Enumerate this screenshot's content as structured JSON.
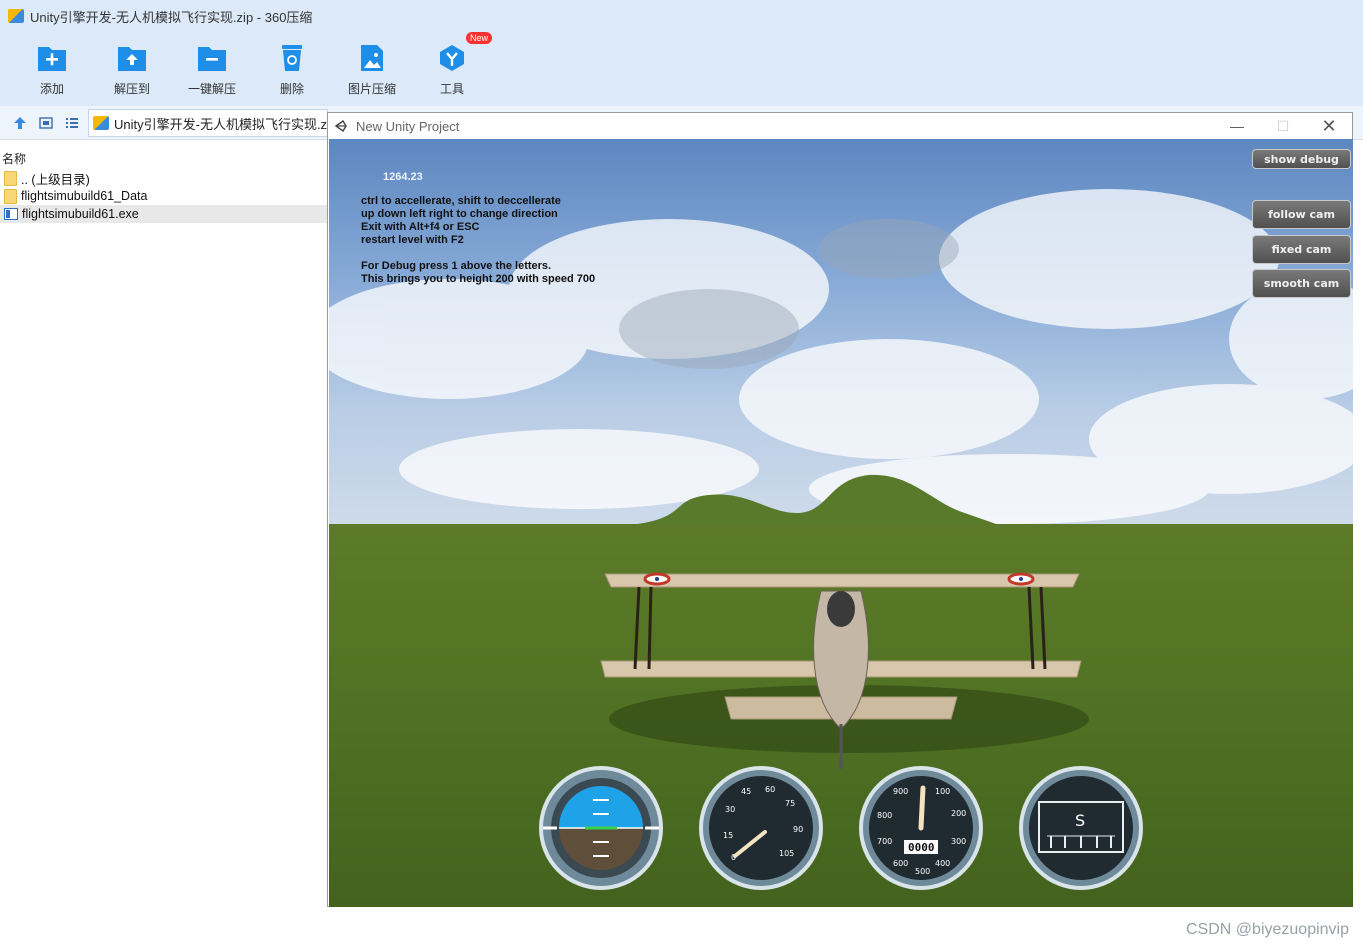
{
  "zip": {
    "title": "Unity引擎开发-无人机模拟飞行实现.zip - 360压缩",
    "toolbar": [
      {
        "label": "添加",
        "icon": "add-icon"
      },
      {
        "label": "解压到",
        "icon": "extract-to-icon"
      },
      {
        "label": "一键解压",
        "icon": "one-click-extract-icon"
      },
      {
        "label": "删除",
        "icon": "delete-icon"
      },
      {
        "label": "图片压缩",
        "icon": "image-compress-icon"
      },
      {
        "label": "工具",
        "icon": "tools-icon",
        "badge": "New"
      }
    ],
    "path": "Unity引擎开发-无人机模拟飞行实现.zip\\",
    "column_name": "名称",
    "files": [
      {
        "name": ".. (上级目录)",
        "type": "folder"
      },
      {
        "name": "flightsimubuild61_Data",
        "type": "folder"
      },
      {
        "name": "flightsimubuild61.exe",
        "type": "exe"
      }
    ]
  },
  "unity": {
    "title": "New Unity Project",
    "fps": "1264.23",
    "instructions": "ctrl to accellerate, shift to deccellerate\nup down left right to change direction\nExit with Alt+f4 or ESC\nrestart level with F2\n\nFor Debug press 1 above the letters.\nThis brings you to height 200 with speed 700",
    "buttons": {
      "show_debug": "show debug",
      "follow_cam": "follow cam",
      "fixed_cam": "fixed cam",
      "smooth_cam": "smooth cam"
    },
    "speed_ticks": [
      "15",
      "30",
      "45",
      "60",
      "75",
      "90",
      "105",
      "0"
    ],
    "alt_ticks": [
      "100",
      "200",
      "300",
      "400",
      "500",
      "600",
      "700",
      "800",
      "900"
    ],
    "alt_readout": "0000",
    "compass_letter": "S"
  },
  "watermark": "CSDN @biyezuopinvip",
  "colors": {
    "zip_bg": "#dbe9f8",
    "icon_blue": "#1e8ee8"
  }
}
